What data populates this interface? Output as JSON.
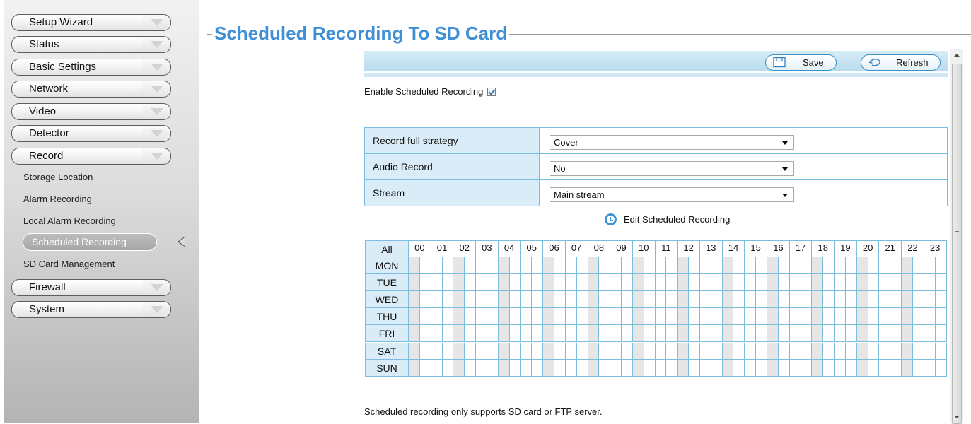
{
  "sidebar": {
    "menus": [
      {
        "label": "Setup Wizard"
      },
      {
        "label": "Status"
      },
      {
        "label": "Basic Settings"
      },
      {
        "label": "Network"
      },
      {
        "label": "Video"
      },
      {
        "label": "Detector"
      },
      {
        "label": "Record"
      }
    ],
    "record_sub": [
      {
        "label": "Storage Location"
      },
      {
        "label": "Alarm Recording"
      },
      {
        "label": "Local Alarm Recording"
      },
      {
        "label": "Scheduled Recording",
        "active": true
      },
      {
        "label": "SD Card Management"
      }
    ],
    "menus_after": [
      {
        "label": "Firewall"
      },
      {
        "label": "System"
      }
    ]
  },
  "page": {
    "title": "Scheduled Recording To SD Card"
  },
  "toolbar": {
    "save_label": "Save",
    "refresh_label": "Refresh"
  },
  "enable": {
    "label": "Enable Scheduled Recording",
    "checked": true
  },
  "settings": [
    {
      "label": "Record full strategy",
      "value": "Cover"
    },
    {
      "label": "Audio Record",
      "value": "No"
    },
    {
      "label": "Stream",
      "value": "Main stream"
    }
  ],
  "edit_schedule_label": "Edit Scheduled Recording",
  "schedule": {
    "all_label": "All",
    "hours": [
      "00",
      "01",
      "02",
      "03",
      "04",
      "05",
      "06",
      "07",
      "08",
      "09",
      "10",
      "11",
      "12",
      "13",
      "14",
      "15",
      "16",
      "17",
      "18",
      "19",
      "20",
      "21",
      "22",
      "23"
    ],
    "days": [
      "MON",
      "TUE",
      "WED",
      "THU",
      "FRI",
      "SAT",
      "SUN"
    ]
  },
  "footnote": "Scheduled recording only supports SD card or FTP server.",
  "colors": {
    "title": "#3f8fd6",
    "grid_border": "#7bbde0",
    "header_bg": "#d9ecf7",
    "shaded_cell": "#e6e6e6"
  }
}
